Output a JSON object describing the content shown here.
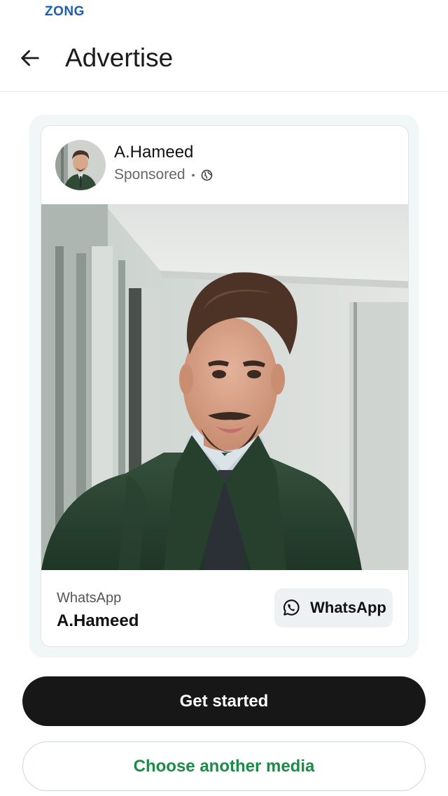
{
  "status_bar": {
    "carrier": "ZONG"
  },
  "header": {
    "title": "Advertise",
    "back_icon": "arrow-left-icon"
  },
  "ad_preview": {
    "author_name": "A.Hameed",
    "sponsored_label": "Sponsored",
    "separator": "•",
    "audience_icon": "globe-icon",
    "image_icon": "portrait-photo",
    "footer_platform": "WhatsApp",
    "footer_name": "A.Hameed",
    "cta_label": "WhatsApp",
    "cta_icon": "whatsapp-icon"
  },
  "actions": {
    "get_started_label": "Get started",
    "choose_media_label": "Choose another media"
  },
  "colors": {
    "primary_button": "#171717",
    "secondary_text": "#1e8a47",
    "carrier": "#1a5fb4"
  }
}
